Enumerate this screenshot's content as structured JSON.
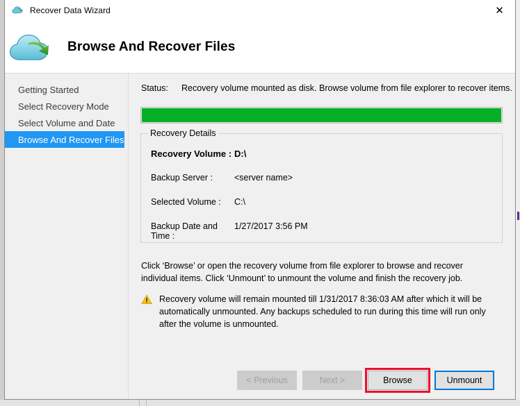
{
  "window": {
    "title": "Recover Data Wizard",
    "title_icon": "cloud-icon",
    "close_label": "✕",
    "accent_color": "#3d9bd6"
  },
  "header": {
    "logo_icon": "cloud-recover-logo",
    "title": "Browse And Recover Files"
  },
  "sidebar": {
    "items": [
      {
        "label": "Getting Started",
        "selected": false
      },
      {
        "label": "Select Recovery Mode",
        "selected": false
      },
      {
        "label": "Select Volume and Date",
        "selected": false
      },
      {
        "label": "Browse And Recover Files",
        "selected": true
      }
    ],
    "selected_color": "#2196f3"
  },
  "content": {
    "status_label": "Status:",
    "status_text": "Recovery volume mounted as disk. Browse volume from file explorer to recover items.",
    "progress": {
      "percent": 100,
      "color": "#06b025"
    },
    "group_title": "Recovery Details",
    "details": [
      {
        "label": "Recovery Volume :",
        "value": "D:\\",
        "emphasis": true
      },
      {
        "label": "Backup Server :",
        "value": "<server name>",
        "emphasis": false
      },
      {
        "label": "Selected Volume :",
        "value": "C:\\",
        "emphasis": false
      },
      {
        "label": "Backup Date and Time :",
        "value": "1/27/2017 3:56 PM",
        "emphasis": false
      }
    ],
    "instructions": "Click ‘Browse’ or open the recovery volume from file explorer to browse and recover individual items. Click ‘Unmount’ to unmount the volume and finish the recovery job.",
    "warning_icon": "warning-triangle-icon",
    "warning_text": "Recovery volume will remain mounted till 1/31/2017 8:36:03 AM after which it will be automatically unmounted. Any backups scheduled to run during this time will run only after the volume is unmounted."
  },
  "footer": {
    "previous_label": "< Previous",
    "next_label": "Next >",
    "browse_label": "Browse",
    "unmount_label": "Unmount",
    "annotation_color": "#e8112d",
    "focus_color": "#0078d7"
  }
}
